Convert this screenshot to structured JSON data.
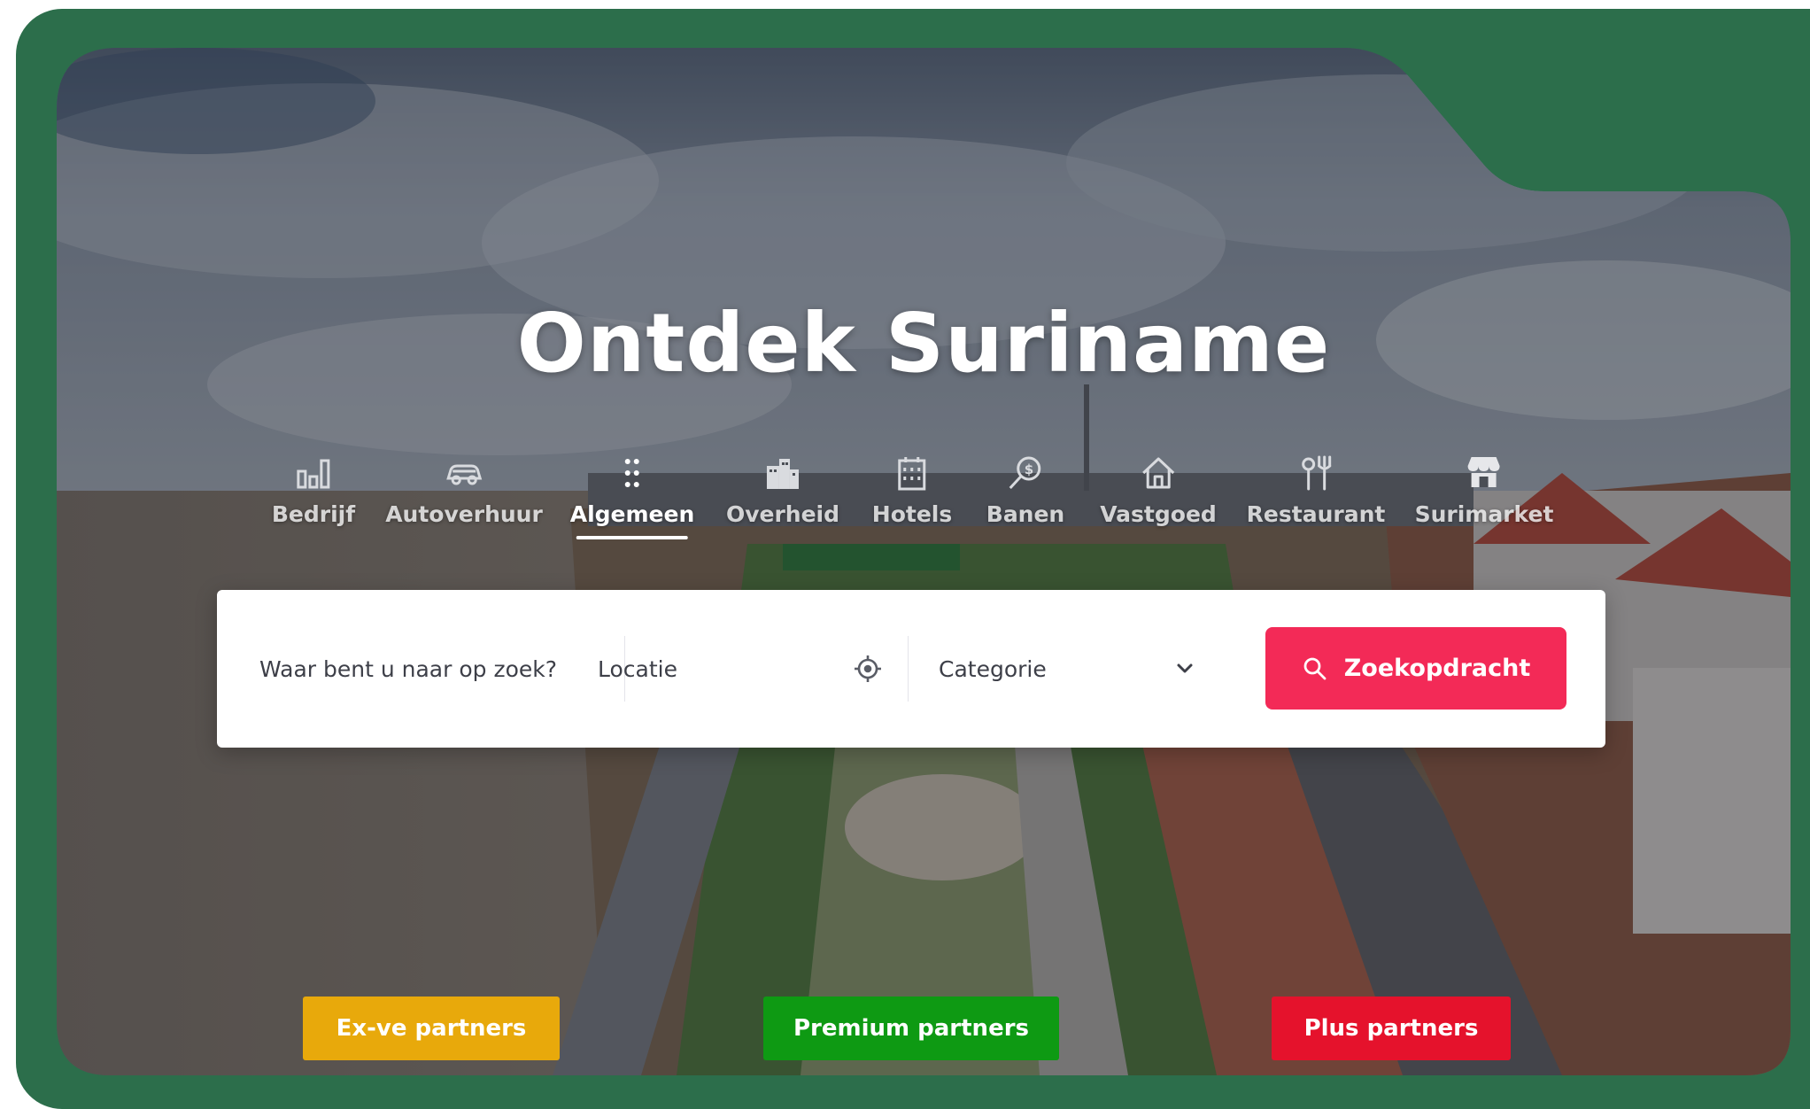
{
  "hero": {
    "title": "Ontdek Suriname"
  },
  "tabs": [
    {
      "label": "Bedrijf",
      "icon": "bar-chart-icon",
      "active": false
    },
    {
      "label": "Autoverhuur",
      "icon": "car-icon",
      "active": false
    },
    {
      "label": "Algemeen",
      "icon": "dots-grid-icon",
      "active": true
    },
    {
      "label": "Overheid",
      "icon": "government-building-icon",
      "active": false
    },
    {
      "label": "Hotels",
      "icon": "hotel-building-icon",
      "active": false
    },
    {
      "label": "Banen",
      "icon": "job-search-dollar-icon",
      "active": false
    },
    {
      "label": "Vastgoed",
      "icon": "house-icon",
      "active": false
    },
    {
      "label": "Restaurant",
      "icon": "fork-knife-icon",
      "active": false
    },
    {
      "label": "Surimarket",
      "icon": "store-icon",
      "active": false
    }
  ],
  "search": {
    "what_placeholder": "Waar bent u naar op zoek?",
    "location_placeholder": "Locatie",
    "category_selected": "Categorie",
    "button_label": "Zoekopdracht"
  },
  "partners": [
    {
      "label": "Ex-ve partners",
      "color": "#e8a90b"
    },
    {
      "label": "Premium partners",
      "color": "#0e9a13"
    },
    {
      "label": "Plus partners",
      "color": "#e5122c"
    }
  ],
  "colors": {
    "frame": "#2c6e4b",
    "accent": "#f32a57"
  }
}
